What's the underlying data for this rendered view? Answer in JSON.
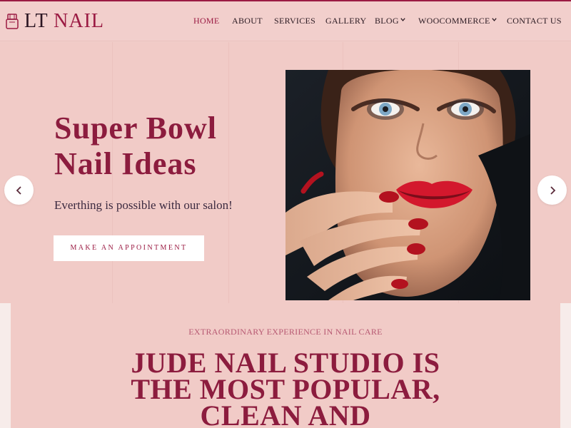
{
  "brand": {
    "name_first": "LT",
    "name_second": "NAIL"
  },
  "nav": {
    "home": "HOME",
    "about": "ABOUT",
    "services": "SERVICES",
    "gallery": "GALLERY",
    "blog": "BLOG",
    "woocommerce": "WOOCOMMERCE",
    "contact": "CONTACT US"
  },
  "hero": {
    "title": "Super Bowl Nail Ideas",
    "subtitle": "Everthing is possible with our salon!",
    "cta_label": "MAKE AN APPOINTMENT"
  },
  "intro": {
    "eyebrow": "EXTRAORDINARY EXPERIENCE IN NAIL CARE",
    "title_line1": "JUDE NAIL STUDIO IS",
    "title_line2": "THE MOST POPULAR,",
    "title_line3": "CLEAN AND"
  },
  "colors": {
    "accent": "#9b1b43",
    "background": "#f1cbc7",
    "button_bg": "#ffffff"
  },
  "icons": {
    "logo": "nail-polish-icon",
    "prev": "chevron-left-icon",
    "next": "chevron-right-icon",
    "dropdown": "chevron-down-icon"
  }
}
